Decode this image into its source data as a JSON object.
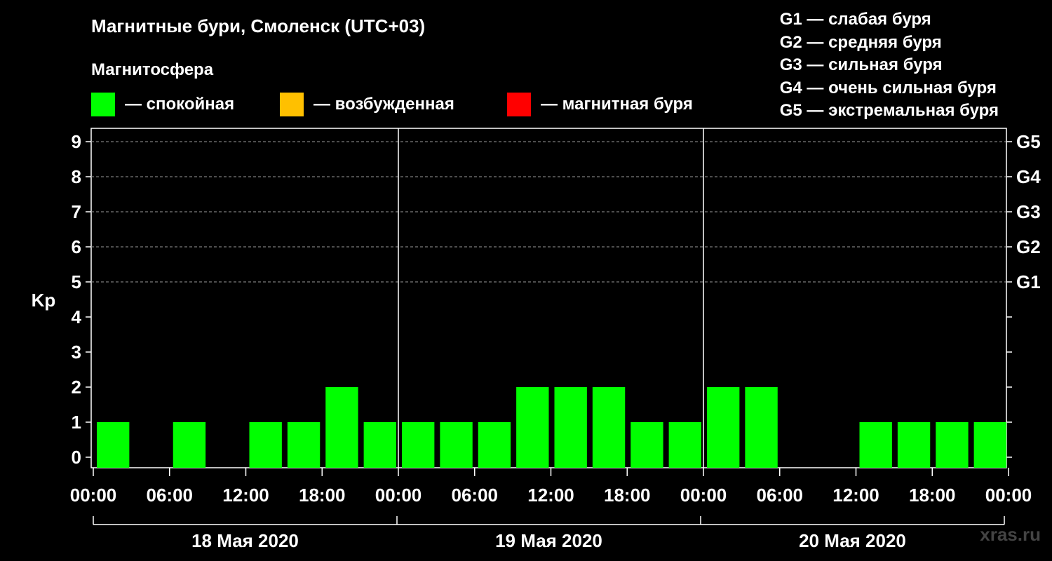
{
  "title": "Магнитные бури, Смоленск (UTC+03)",
  "subtitle": "Магнитосфера",
  "legend": [
    {
      "label": "— спокойная",
      "color": "#00ff00"
    },
    {
      "label": "— возбужденная",
      "color": "#ffc000"
    },
    {
      "label": "— магнитная буря",
      "color": "#ff0000"
    }
  ],
  "storm_levels": [
    "G1 — слабая буря",
    "G2 — средняя буря",
    "G3 — сильная буря",
    "G4 — очень сильная буря",
    "G5 — экстремальная буря"
  ],
  "watermark": "xras.ru",
  "chart_data": {
    "type": "bar",
    "ylabel": "Kp",
    "ylim": [
      0,
      9
    ],
    "yticks": [
      "0",
      "1",
      "2",
      "3",
      "4",
      "5",
      "6",
      "7",
      "8",
      "9"
    ],
    "right_ticks": [
      {
        "y": 5,
        "label": "G1"
      },
      {
        "y": 6,
        "label": "G2"
      },
      {
        "y": 7,
        "label": "G3"
      },
      {
        "y": 8,
        "label": "G4"
      },
      {
        "y": 9,
        "label": "G5"
      }
    ],
    "grid": "dashed horizontal lines at Kp 5–9",
    "x_tick_labels": [
      "00:00",
      "06:00",
      "12:00",
      "18:00",
      "00:00",
      "06:00",
      "12:00",
      "18:00",
      "00:00",
      "06:00",
      "12:00",
      "18:00",
      "00:00"
    ],
    "days": [
      "18 Мая 2020",
      "19 Мая 2020",
      "20 Мая 2020"
    ],
    "interval_hours": 3,
    "series": [
      {
        "color": "#00ff00",
        "values": [
          1,
          0,
          1,
          0,
          1,
          1,
          2,
          1,
          1,
          1,
          1,
          2,
          2,
          2,
          1,
          1,
          2,
          2,
          0,
          0,
          1,
          1,
          1,
          1
        ]
      }
    ]
  }
}
